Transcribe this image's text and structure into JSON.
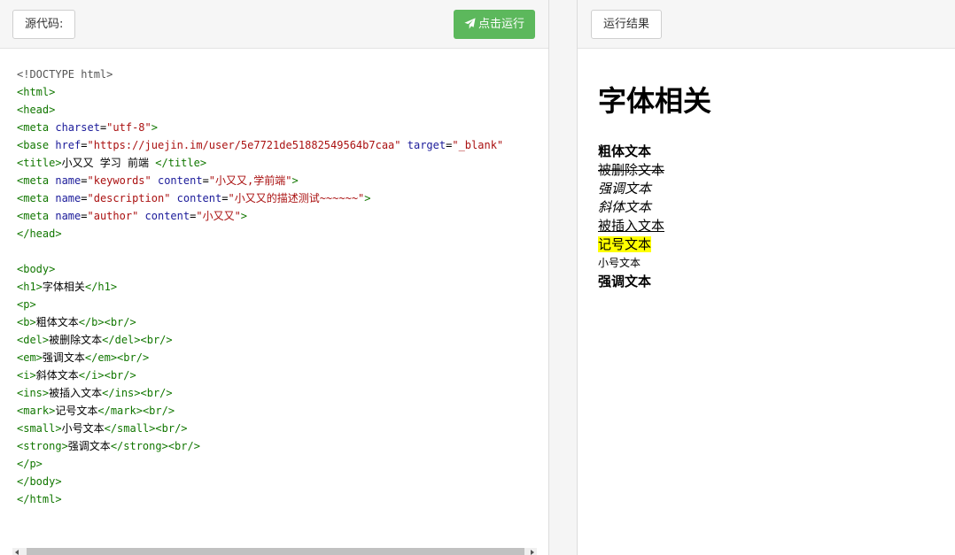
{
  "left_panel": {
    "source_label": "源代码:",
    "run_button": "点击运行",
    "code_lines": [
      [
        {
          "t": "doc",
          "v": "<!DOCTYPE html>"
        }
      ],
      [
        {
          "t": "tag",
          "v": "<html>"
        }
      ],
      [
        {
          "t": "tag",
          "v": "<head>"
        }
      ],
      [
        {
          "t": "tag",
          "v": "<meta "
        },
        {
          "t": "attr",
          "v": "charset"
        },
        {
          "t": "txt",
          "v": "="
        },
        {
          "t": "str",
          "v": "\"utf-8\""
        },
        {
          "t": "tag",
          "v": ">"
        }
      ],
      [
        {
          "t": "tag",
          "v": "<base "
        },
        {
          "t": "attr",
          "v": "href"
        },
        {
          "t": "txt",
          "v": "="
        },
        {
          "t": "str",
          "v": "\"https://juejin.im/user/5e7721de51882549564b7caa\""
        },
        {
          "t": "txt",
          "v": " "
        },
        {
          "t": "attr",
          "v": "target"
        },
        {
          "t": "txt",
          "v": "="
        },
        {
          "t": "str",
          "v": "\"_blank\""
        }
      ],
      [
        {
          "t": "tag",
          "v": "<title>"
        },
        {
          "t": "txt",
          "v": "小又又 学习 前端 "
        },
        {
          "t": "tag",
          "v": "</title>"
        }
      ],
      [
        {
          "t": "tag",
          "v": "<meta "
        },
        {
          "t": "attr",
          "v": "name"
        },
        {
          "t": "txt",
          "v": "="
        },
        {
          "t": "str",
          "v": "\"keywords\""
        },
        {
          "t": "txt",
          "v": " "
        },
        {
          "t": "attr",
          "v": "content"
        },
        {
          "t": "txt",
          "v": "="
        },
        {
          "t": "str",
          "v": "\"小又又,学前端\""
        },
        {
          "t": "tag",
          "v": ">"
        }
      ],
      [
        {
          "t": "tag",
          "v": "<meta "
        },
        {
          "t": "attr",
          "v": "name"
        },
        {
          "t": "txt",
          "v": "="
        },
        {
          "t": "str",
          "v": "\"description\""
        },
        {
          "t": "txt",
          "v": " "
        },
        {
          "t": "attr",
          "v": "content"
        },
        {
          "t": "txt",
          "v": "="
        },
        {
          "t": "str",
          "v": "\"小又又的描述测试~~~~~~\""
        },
        {
          "t": "tag",
          "v": ">"
        }
      ],
      [
        {
          "t": "tag",
          "v": "<meta "
        },
        {
          "t": "attr",
          "v": "name"
        },
        {
          "t": "txt",
          "v": "="
        },
        {
          "t": "str",
          "v": "\"author\""
        },
        {
          "t": "txt",
          "v": " "
        },
        {
          "t": "attr",
          "v": "content"
        },
        {
          "t": "txt",
          "v": "="
        },
        {
          "t": "str",
          "v": "\"小又又\""
        },
        {
          "t": "tag",
          "v": ">"
        }
      ],
      [
        {
          "t": "tag",
          "v": "</head>"
        }
      ],
      [],
      [
        {
          "t": "tag",
          "v": "<body>"
        }
      ],
      [
        {
          "t": "tag",
          "v": "<h1>"
        },
        {
          "t": "txt",
          "v": "字体相关"
        },
        {
          "t": "tag",
          "v": "</h1>"
        }
      ],
      [
        {
          "t": "tag",
          "v": "<p>"
        }
      ],
      [
        {
          "t": "tag",
          "v": "<b>"
        },
        {
          "t": "txt",
          "v": "粗体文本"
        },
        {
          "t": "tag",
          "v": "</b><br/>"
        }
      ],
      [
        {
          "t": "tag",
          "v": "<del>"
        },
        {
          "t": "txt",
          "v": "被删除文本"
        },
        {
          "t": "tag",
          "v": "</del><br/>"
        }
      ],
      [
        {
          "t": "tag",
          "v": "<em>"
        },
        {
          "t": "txt",
          "v": "强调文本"
        },
        {
          "t": "tag",
          "v": "</em><br/>"
        }
      ],
      [
        {
          "t": "tag",
          "v": "<i>"
        },
        {
          "t": "txt",
          "v": "斜体文本"
        },
        {
          "t": "tag",
          "v": "</i><br/>"
        }
      ],
      [
        {
          "t": "tag",
          "v": "<ins>"
        },
        {
          "t": "txt",
          "v": "被插入文本"
        },
        {
          "t": "tag",
          "v": "</ins><br/>"
        }
      ],
      [
        {
          "t": "tag",
          "v": "<mark>"
        },
        {
          "t": "txt",
          "v": "记号文本"
        },
        {
          "t": "tag",
          "v": "</mark><br/>"
        }
      ],
      [
        {
          "t": "tag",
          "v": "<small>"
        },
        {
          "t": "txt",
          "v": "小号文本"
        },
        {
          "t": "tag",
          "v": "</small><br/>"
        }
      ],
      [
        {
          "t": "tag",
          "v": "<strong>"
        },
        {
          "t": "txt",
          "v": "强调文本"
        },
        {
          "t": "tag",
          "v": "</strong><br/>"
        }
      ],
      [
        {
          "t": "tag",
          "v": "</p>"
        }
      ],
      [
        {
          "t": "tag",
          "v": "</body>"
        }
      ],
      [
        {
          "t": "tag",
          "v": "</html>"
        }
      ]
    ]
  },
  "right_panel": {
    "result_label": "运行结果",
    "heading": "字体相关",
    "bold": "粗体文本",
    "deleted": "被删除文本",
    "emphasis": "强调文本",
    "italic": "斜体文本",
    "inserted": "被插入文本",
    "marked": "记号文本",
    "small": "小号文本",
    "strong": "强调文本"
  },
  "colors": {
    "run_button": "#5cb85c",
    "code_tag": "#117700",
    "code_attr": "#1b1b9a",
    "code_string": "#aa1111",
    "mark_highlight": "#ffff00"
  },
  "icons": {
    "run_button_icon": "paper-plane-icon"
  }
}
